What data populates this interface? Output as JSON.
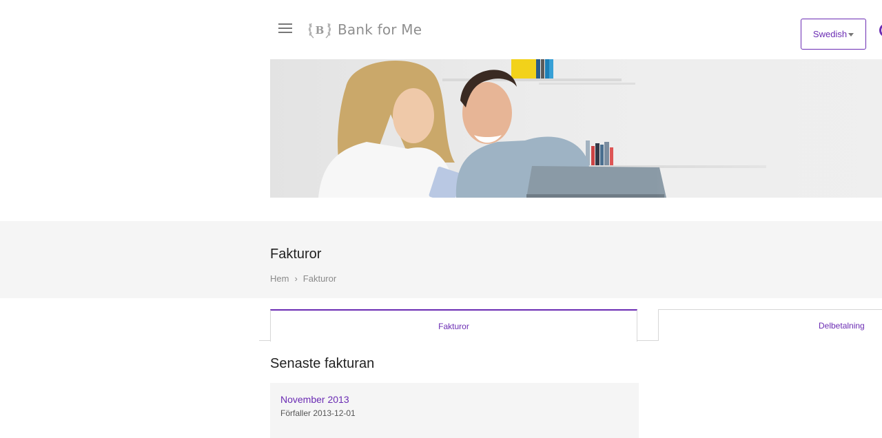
{
  "header": {
    "brand": "Bank for Me",
    "logo_letter": "B",
    "language_label": "Swedish"
  },
  "colors": {
    "accent": "#6a2bb3",
    "band_background": "#f5f5f5",
    "muted_text": "#8a8a8a"
  },
  "page": {
    "title": "Fakturor",
    "breadcrumb": [
      "Hem",
      "›",
      "Fakturor"
    ]
  },
  "tabs": [
    {
      "label": "Fakturor",
      "active": true
    },
    {
      "label": "Delbetalning",
      "active": false
    }
  ],
  "latest_invoice": {
    "heading": "Senaste fakturan",
    "month": "November 2013",
    "due": "Förfaller 2013-12-01"
  },
  "icons": {
    "menu": "hamburger-menu-icon",
    "logo": "laurel-logo-icon",
    "dropdown": "caret-down-icon",
    "user": "user-avatar-icon"
  }
}
